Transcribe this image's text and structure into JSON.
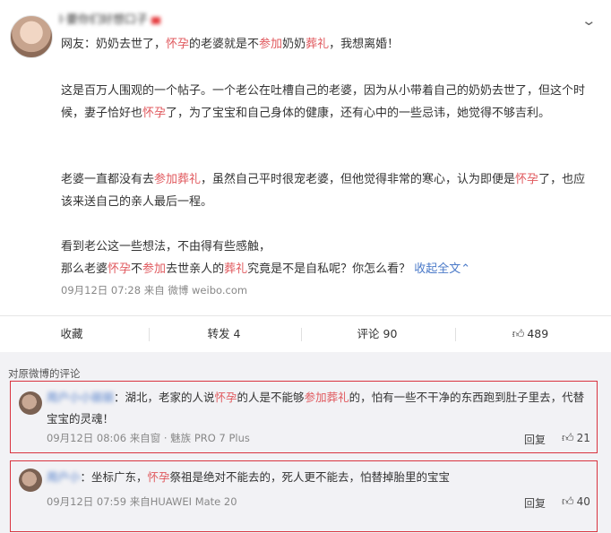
{
  "post": {
    "username": "I·要你们好想口子",
    "headline_parts": [
      {
        "t": "网友：奶奶去世了，",
        "hl": false
      },
      {
        "t": "怀孕",
        "hl": true
      },
      {
        "t": "的老婆就是不",
        "hl": false
      },
      {
        "t": "参加",
        "hl": true
      },
      {
        "t": "奶奶",
        "hl": false
      },
      {
        "t": "葬礼",
        "hl": true
      },
      {
        "t": "，我想离婚！",
        "hl": false
      }
    ],
    "p1_parts": [
      {
        "t": "这是百万人围观的一个帖子。一个老公在吐槽自己的老婆，因为从小带着自己的奶奶去世了，但这个时候，妻子恰好也",
        "hl": false
      },
      {
        "t": "怀孕",
        "hl": true
      },
      {
        "t": "了，为了宝宝和自己身体的健康，还有心中的一些忌讳，她觉得不够吉利。",
        "hl": false
      }
    ],
    "p2_parts": [
      {
        "t": "老婆一直都没有去",
        "hl": false
      },
      {
        "t": "参加葬礼",
        "hl": true
      },
      {
        "t": "，虽然自己平时很宠老婆，但他觉得非常的寒心，认为即便是",
        "hl": false
      },
      {
        "t": "怀孕",
        "hl": true
      },
      {
        "t": "了，也应该来送自己的亲人最后一程。",
        "hl": false
      }
    ],
    "p3_line1": "看到老公这一些想法，不由得有些感触，",
    "p3_parts": [
      {
        "t": "那么老婆",
        "hl": false
      },
      {
        "t": "怀孕",
        "hl": true
      },
      {
        "t": "不",
        "hl": false
      },
      {
        "t": "参加",
        "hl": true
      },
      {
        "t": "去世亲人的",
        "hl": false
      },
      {
        "t": "葬礼",
        "hl": true
      },
      {
        "t": "究竟是不是自私呢？你怎么看？ ",
        "hl": false
      }
    ],
    "expand_label": "收起全文",
    "expand_icon": "chevron-up-icon",
    "meta": "09月12日 07:28  来自 微博 weibo.com"
  },
  "actions": {
    "favorite": "收藏",
    "repost": "转发 4",
    "comment": "评论 90",
    "like_count": "489"
  },
  "comments": {
    "title": "对原微博的评论",
    "items": [
      {
        "name": "用户小小丽丽",
        "text_parts": [
          {
            "t": "：湖北，老家的人说",
            "hl": false
          },
          {
            "t": "怀孕",
            "hl": true
          },
          {
            "t": "的人是不能够",
            "hl": false
          },
          {
            "t": "参加葬礼",
            "hl": true
          },
          {
            "t": "的，怕有一些不干净的东西跑到肚子里去，代替宝宝的灵魂！",
            "hl": false
          }
        ],
        "meta": "09月12日 08:06  来自窗 · 魅族 PRO 7 Plus",
        "reply": "回复",
        "likes": "21"
      },
      {
        "name": "用户小",
        "text_parts": [
          {
            "t": "：坐标广东，",
            "hl": false
          },
          {
            "t": "怀孕",
            "hl": true
          },
          {
            "t": "祭祖是绝对不能去的，死人更不能去，怕替掉胎里的宝宝",
            "hl": false
          }
        ],
        "meta": "09月12日 07:59  来自HUAWEI Mate 20",
        "reply": "回复",
        "likes": "40"
      }
    ]
  },
  "colors": {
    "highlight": "#e0595e",
    "link": "#4a79c8",
    "annotation_box": "#d9333f"
  }
}
